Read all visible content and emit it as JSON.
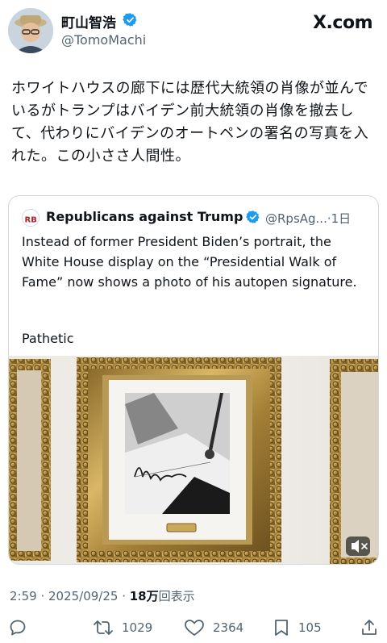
{
  "post": {
    "author": {
      "name": "町山智浩",
      "handle": "@TomoMachi",
      "verified": true
    },
    "brand": "X.com",
    "text": "ホワイトハウスの廊下には歴代大統領の肖像が並んでいるがトランプはバイデン前大統領の肖像を撤去して、代わりにバイデンのオートペンの署名の写真を入れた。この小ささ人間性。",
    "quoted": {
      "logo_text": "RB",
      "name": "Republicans against Trump",
      "verified": true,
      "handle": "@RpsAg...",
      "time": "·1日",
      "text": "Instead of former President Biden’s portrait, the White House display on the “Presidential Walk of Fame” now shows a photo of his autopen signature.",
      "tail": "Pathetic",
      "media": {
        "type": "photo",
        "subject": "ornate gold frame holding a photo of an autopen signature"
      }
    },
    "timestamp": "2:59 · 2025/09/25 · ",
    "views_count": "18万",
    "views_label": "回表示",
    "actions": {
      "reply_count": "",
      "repost_count": "1029",
      "like_count": "2364",
      "bookmark_count": "105"
    },
    "icons": {
      "verified": "verified-badge-icon",
      "reply": "reply-icon",
      "repost": "repost-icon",
      "like": "heart-icon",
      "bookmark": "bookmark-icon",
      "share": "share-icon",
      "mute": "mute-icon"
    },
    "colors": {
      "verified_blue": "#1d9bf0",
      "text_primary": "#0f1419",
      "text_secondary": "#536471",
      "border": "#cfd9de"
    }
  }
}
